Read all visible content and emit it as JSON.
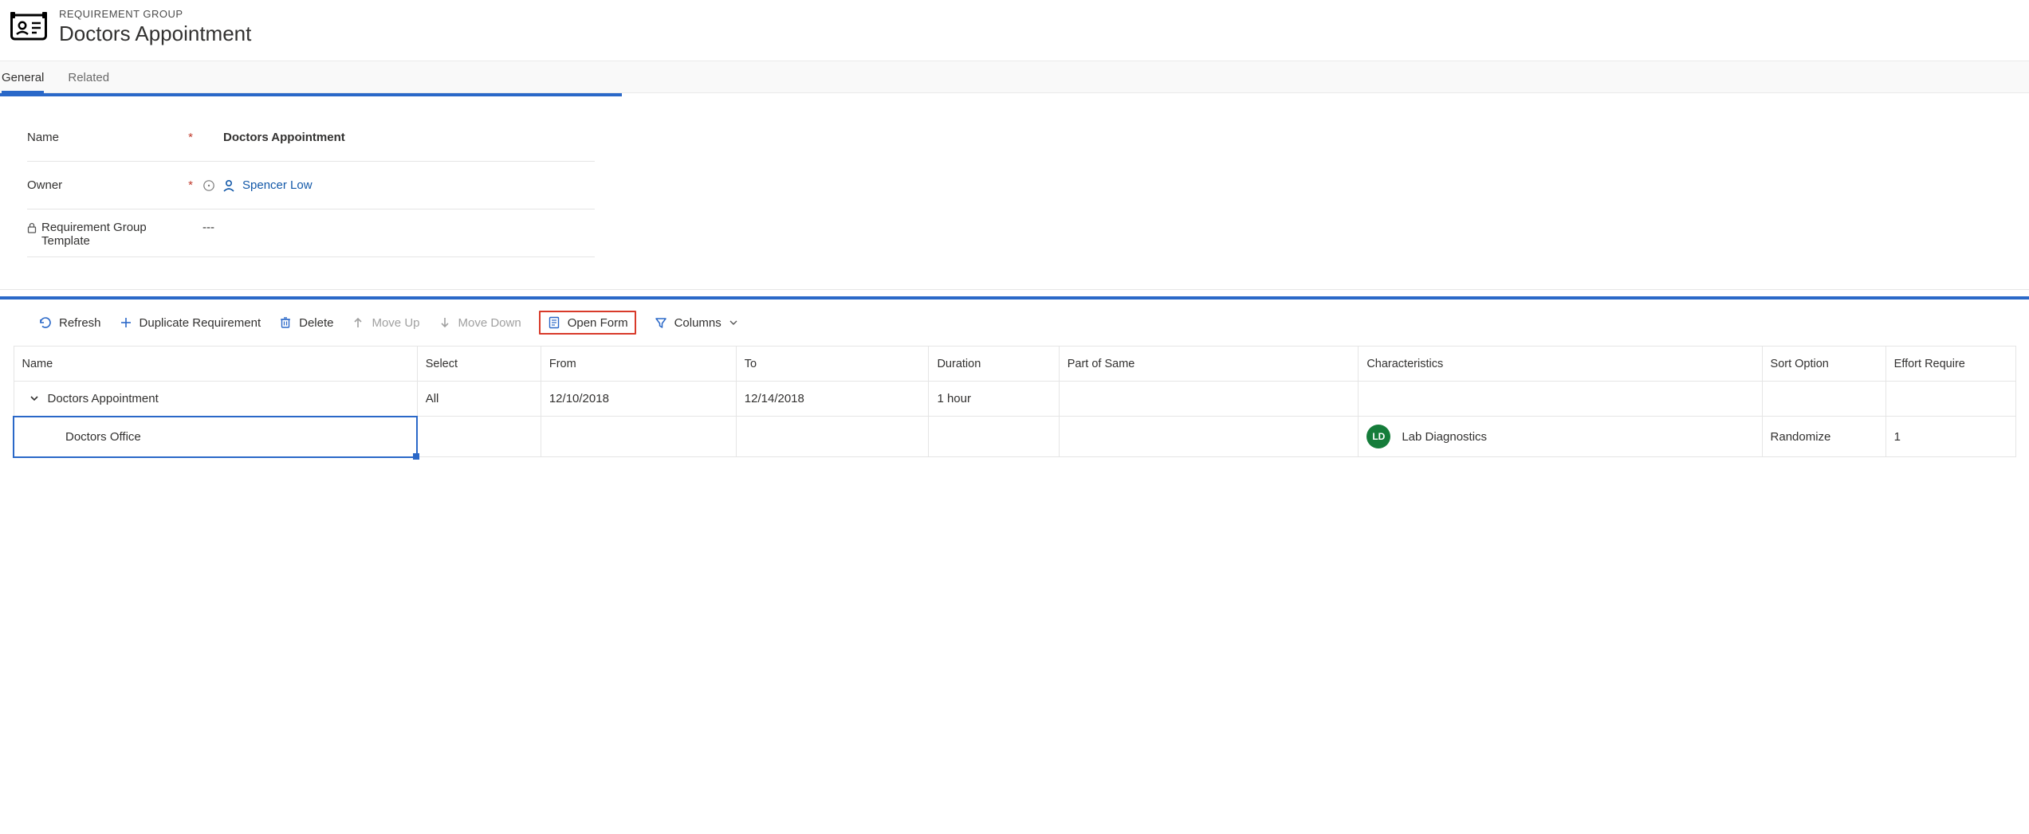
{
  "header": {
    "label": "REQUIREMENT GROUP",
    "title": "Doctors Appointment"
  },
  "tabs": {
    "general": "General",
    "related": "Related"
  },
  "form": {
    "name_label": "Name",
    "name_value": "Doctors Appointment",
    "owner_label": "Owner",
    "owner_value": "Spencer Low",
    "template_label": "Requirement Group Template",
    "template_value": "---"
  },
  "toolbar": {
    "refresh": "Refresh",
    "duplicate": "Duplicate Requirement",
    "delete": "Delete",
    "move_up": "Move Up",
    "move_down": "Move Down",
    "open_form": "Open Form",
    "columns": "Columns"
  },
  "grid": {
    "headers": {
      "name": "Name",
      "select": "Select",
      "from": "From",
      "to": "To",
      "duration": "Duration",
      "part_of_same": "Part of Same",
      "characteristics": "Characteristics",
      "sort_option": "Sort Option",
      "effort_required": "Effort Require"
    },
    "rows": [
      {
        "name": "Doctors Appointment",
        "select": "All",
        "from": "12/10/2018",
        "to": "12/14/2018",
        "duration": "1 hour",
        "part_of_same": "",
        "characteristics": "",
        "char_avatar": "",
        "sort_option": "",
        "effort_required": ""
      },
      {
        "name": "Doctors Office",
        "select": "",
        "from": "",
        "to": "",
        "duration": "",
        "part_of_same": "",
        "characteristics": "Lab Diagnostics",
        "char_avatar": "LD",
        "sort_option": "Randomize",
        "effort_required": "1"
      }
    ]
  }
}
